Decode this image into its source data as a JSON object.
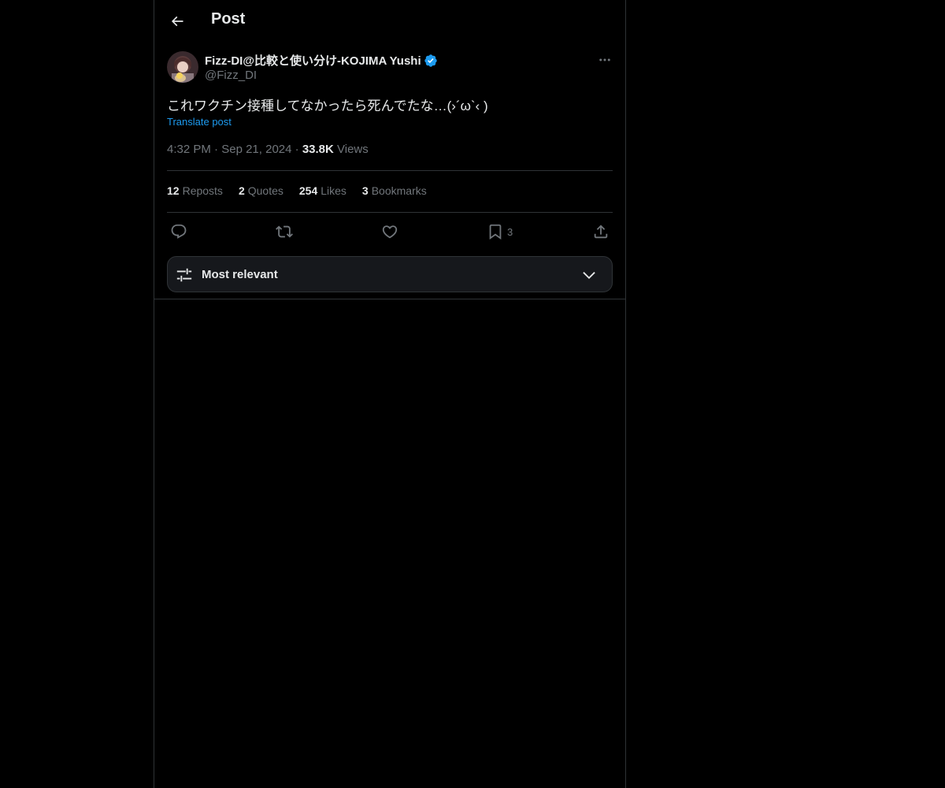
{
  "header": {
    "title": "Post"
  },
  "author": {
    "name": "Fizz-DI@比較と使い分け-KOJIMA Yushi",
    "handle": "@Fizz_DI",
    "verified": true
  },
  "post": {
    "text": "これワクチン接種してなかったら死んでたな…(›´ω`‹ )",
    "translate_label": "Translate post",
    "time": "4:32 PM",
    "date": "Sep 21, 2024",
    "separator": "·",
    "views_count": "33.8K",
    "views_label": "Views"
  },
  "stats": [
    {
      "count": "12",
      "label": "Reposts"
    },
    {
      "count": "2",
      "label": "Quotes"
    },
    {
      "count": "254",
      "label": "Likes"
    },
    {
      "count": "3",
      "label": "Bookmarks"
    }
  ],
  "actions": {
    "reply": {
      "icon": "reply-icon"
    },
    "repost": {
      "icon": "repost-icon"
    },
    "like": {
      "icon": "heart-icon"
    },
    "bookmark": {
      "icon": "bookmark-icon",
      "count": "3"
    },
    "share": {
      "icon": "share-icon"
    }
  },
  "sort": {
    "label": "Most relevant"
  },
  "colors": {
    "background": "#000000",
    "text": "#e7e9ea",
    "muted": "#71767b",
    "accent": "#1d9bf0",
    "border": "#2f3336"
  }
}
